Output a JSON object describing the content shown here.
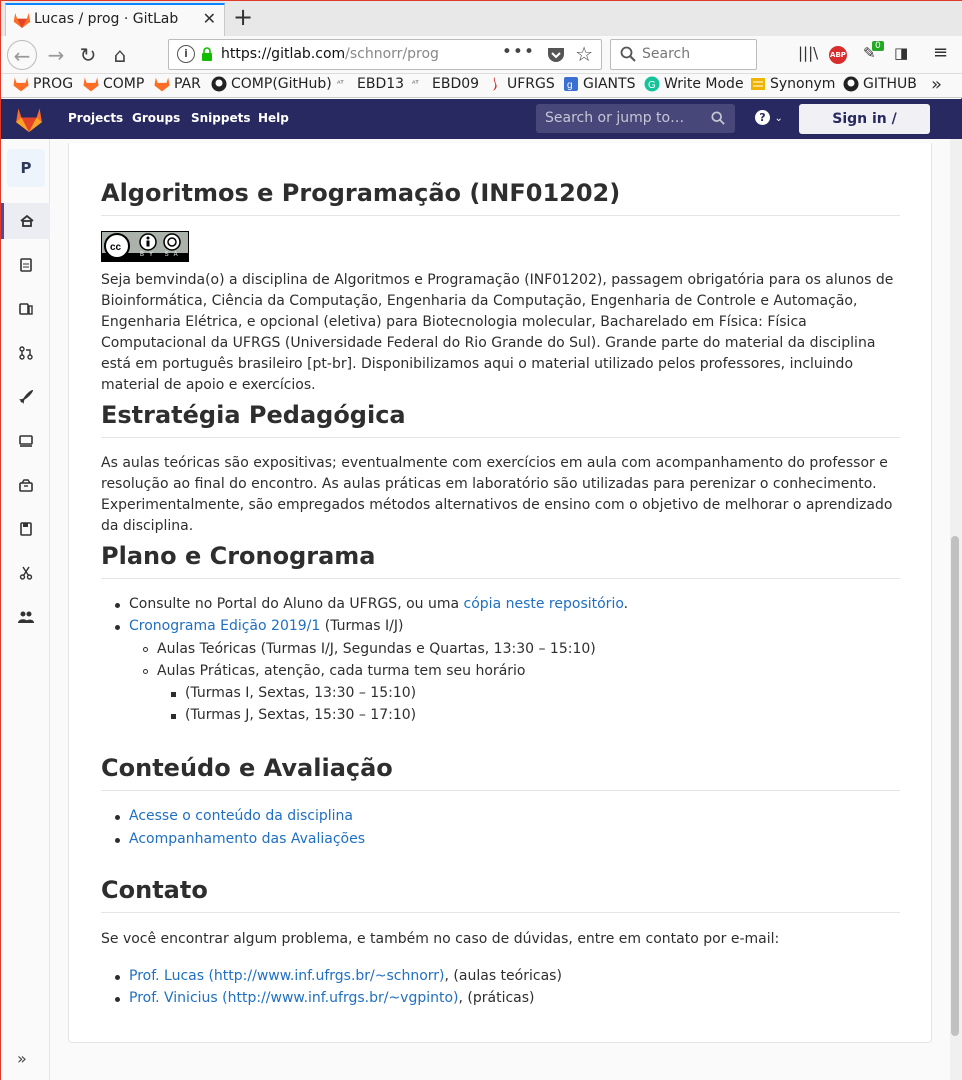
{
  "browser": {
    "tab_title": "Lucas / prog · GitLab",
    "url_host": "https://gitlab.com",
    "url_path": "/schnorr/prog",
    "search_placeholder": "Search",
    "badge_count": "0",
    "bookmarks": [
      "PROG",
      "COMP",
      "PAR",
      "COMP(GitHub)",
      "EBD13",
      "EBD09",
      "UFRGS",
      "GIANTS",
      "Write Mode",
      "Synonym",
      "GITHUB"
    ]
  },
  "gitlab": {
    "nav": [
      "Projects",
      "Groups",
      "Snippets",
      "Help"
    ],
    "search_placeholder": "Search or jump to…",
    "signin_label": "Sign in / Register",
    "project_initial": "P"
  },
  "colors": {
    "header_bg": "#292961",
    "link": "#1f6fc2",
    "gitlab_orange": "#fc6d26"
  },
  "content": {
    "h_intro": "Algoritmos e Programação (INF01202)",
    "license_badge": "BY SA",
    "intro": "Seja bemvinda(o) a disciplina de Algoritmos e Programação (INF01202), passagem obrigatória para os alunos de Bioinformática, Ciência da Computação, Engenharia da Computação, Engenharia de Controle e Automação, Engenharia Elétrica, e opcional (eletiva) para Biotecnologia molecular, Bacharelado em Física: Física Computacional da UFRGS (Universidade Federal do Rio Grande do Sul). Grande parte do material da disciplina está em português brasileiro [pt-br]. Disponibilizamos aqui o material utilizado pelos professores, incluindo material de apoio e exercícios.",
    "h_estrategia": "Estratégia Pedagógica",
    "estrategia": "As aulas teóricas são expositivas; eventualmente com exercícios em aula com acompanhamento do professor e resolução ao final do encontro. As aulas práticas em laboratório são utilizadas para perenizar o conhecimento. Experimentalmente, são empregados métodos alternativos de ensino com o objetivo de melhorar o aprendizado da disciplina.",
    "h_plano": "Plano e Cronograma",
    "plano_1_text": "Consulte no Portal do Aluno da UFRGS, ou uma ",
    "plano_1_link": "cópia neste repositório",
    "plano_1_end": ".",
    "plano_2_link": "Cronograma Edição 2019/1",
    "plano_2_text": " (Turmas I/J)",
    "plano_2a": "Aulas Teóricas (Turmas I/J, Segundas e Quartas, 13:30 – 15:10)",
    "plano_2b": "Aulas Práticas, atenção, cada turma tem seu horário",
    "plano_2b1": "(Turmas I, Sextas, 13:30 – 15:10)",
    "plano_2b2": "(Turmas J, Sextas, 15:30 – 17:10)",
    "h_conteudo": "Conteúdo e Avaliação",
    "conteudo_1": "Acesse o conteúdo da disciplina",
    "conteudo_2": "Acompanhamento das Avaliações",
    "h_contato": "Contato",
    "contato": "Se você encontrar algum problema, e também no caso de dúvidas, entre em contato por e-mail:",
    "contato_1_link": "Prof. Lucas (http://www.inf.ufrgs.br/~schnorr)",
    "contato_1_text": ", (aulas teóricas)",
    "contato_2_link": "Prof. Vinicius (http://www.inf.ufrgs.br/~vgpinto)",
    "contato_2_text": ", (práticas)"
  }
}
